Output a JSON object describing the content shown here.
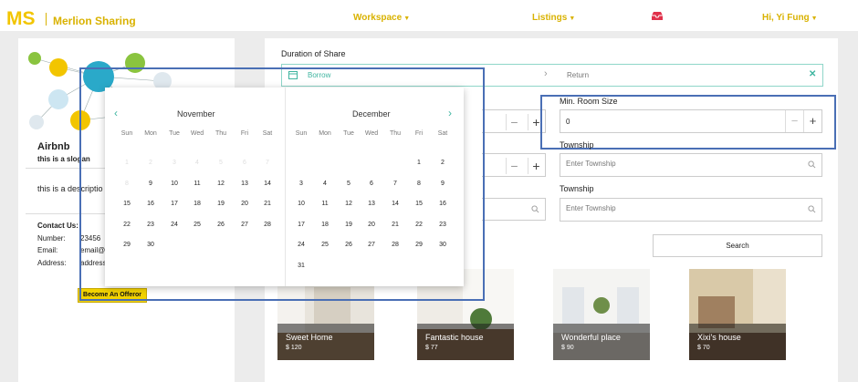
{
  "brand": {
    "logo_text": "MS",
    "name": "Merlion Sharing",
    "color": "#d9b200"
  },
  "nav": {
    "workspace": "Workspace",
    "listings": "Listings",
    "user": "Hi, Yi Fung",
    "inbox_icon": "inbox-icon"
  },
  "company": {
    "name": "Airbnb",
    "slogan": "this is a slogan",
    "description": "this is a descriptio",
    "contact_title": "Contact Us:",
    "number_label": "Number:",
    "number_value": "23456",
    "email_label": "Email:",
    "email_value": "email@",
    "address_label": "Address:",
    "address_value": "address",
    "offeror_button": "Become An Offeror"
  },
  "search": {
    "duration_label": "Duration of Share",
    "borrow_placeholder": "Borrow",
    "return_placeholder": "Return",
    "room_size_label": "Min. Room Size",
    "room_size_value": "0",
    "township_label_1": "Township",
    "township_label_2": "Township",
    "township_placeholder": "Enter Township",
    "search_button": "Search",
    "accent": "#3fb5a0"
  },
  "calendar": {
    "weekdays": [
      "Sun",
      "Mon",
      "Tue",
      "Wed",
      "Thu",
      "Fri",
      "Sat"
    ],
    "months": [
      {
        "name": "November",
        "first_weekday": 0,
        "disabled": 8,
        "days": [
          "1",
          "2",
          "3",
          "4",
          "5",
          "6",
          "7",
          "8",
          "9",
          "10",
          "11",
          "12",
          "13",
          "14",
          "15",
          "16",
          "17",
          "18",
          "19",
          "20",
          "21",
          "22",
          "23",
          "24",
          "25",
          "26",
          "27",
          "28",
          "29",
          "30"
        ]
      },
      {
        "name": "December",
        "first_weekday": 5,
        "disabled": 0,
        "days": [
          "1",
          "2",
          "3",
          "4",
          "5",
          "6",
          "7",
          "8",
          "9",
          "10",
          "11",
          "12",
          "13",
          "14",
          "15",
          "16",
          "17",
          "18",
          "19",
          "20",
          "21",
          "22",
          "23",
          "24",
          "25",
          "26",
          "27",
          "28",
          "29",
          "30",
          "31"
        ]
      }
    ]
  },
  "listings": [
    {
      "name": "Sweet Home",
      "price": "$ 120"
    },
    {
      "name": "Fantastic house",
      "price": "$ 77"
    },
    {
      "name": "Wonderful place",
      "price": "$ 90"
    },
    {
      "name": "Xixi's house",
      "price": "$ 70"
    }
  ]
}
